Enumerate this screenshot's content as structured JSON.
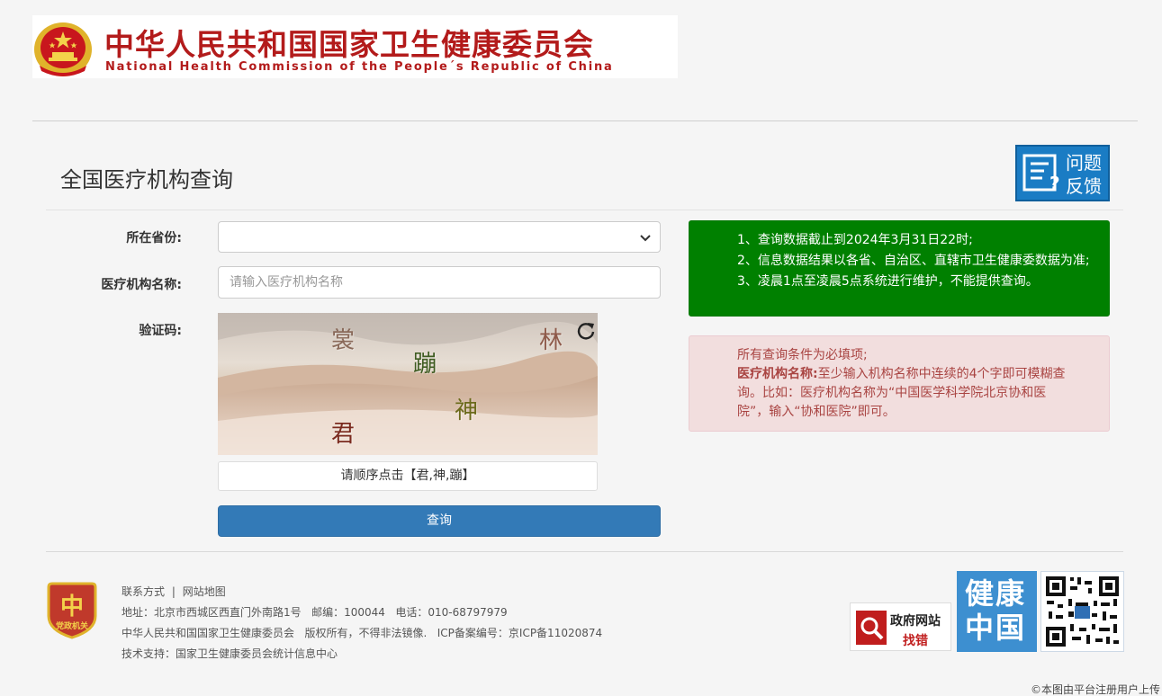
{
  "header": {
    "title_cn": "中华人民共和国国家卫生健康委员会",
    "title_en": "National Health Commission of the People´s Republic of China",
    "emblem_icon": "national-emblem-icon"
  },
  "page": {
    "title": "全国医疗机构查询",
    "feedback_label": "问题反馈"
  },
  "form": {
    "province_label": "所在省份:",
    "province_value": "",
    "institution_label": "医疗机构名称:",
    "institution_placeholder": "请输入医疗机构名称",
    "captcha_label": "验证码:",
    "captcha_chars": [
      "裳",
      "林",
      "蹦",
      "神",
      "君"
    ],
    "captcha_hint": "请顺序点击【君,神,蹦】",
    "submit_label": "查询"
  },
  "notice": {
    "lines": [
      "1、查询数据截止到2024年3月31日22时;",
      "2、信息数据结果以各省、自治区、直辖市卫生健康委数据为准;",
      "3、凌晨1点至凌晨5点系统进行维护，不能提供查询。"
    ]
  },
  "requirement": {
    "line1": "所有查询条件为必填项;",
    "bold_label": "医疗机构名称:",
    "text": "至少输入机构名称中连续的4个字即可模糊查询。比如：医疗机构名称为“中国医学科学院北京协和医院”，输入“协和医院”即可。"
  },
  "footer": {
    "contact_link": "联系方式",
    "separator": "|",
    "sitemap_link": "网站地图",
    "address": "地址：北京市西城区西直门外南路1号",
    "postcode": "邮编：100044",
    "phone": "电话：010-68797979",
    "copyright_org": "中华人民共和国国家卫生健康委员会",
    "copyright_text": "版权所有，不得非法镜像.",
    "icp": "ICP备案编号：京ICP备11020874",
    "tech_support": "技术支持：国家卫生健康委员会统计信息中心",
    "party_badge_text": "党政机关",
    "gov_error_line1": "政府网站",
    "gov_error_line2": "找错",
    "health_china": "健康中国"
  },
  "watermark": "©本图由平台注册用户上传",
  "colors": {
    "brand_red": "#b31b1b",
    "notice_green": "#008000",
    "alert_bg": "#f2dede",
    "alert_text": "#a94442",
    "primary_button": "#337ab7",
    "feedback_blue": "#1a7cc4"
  }
}
